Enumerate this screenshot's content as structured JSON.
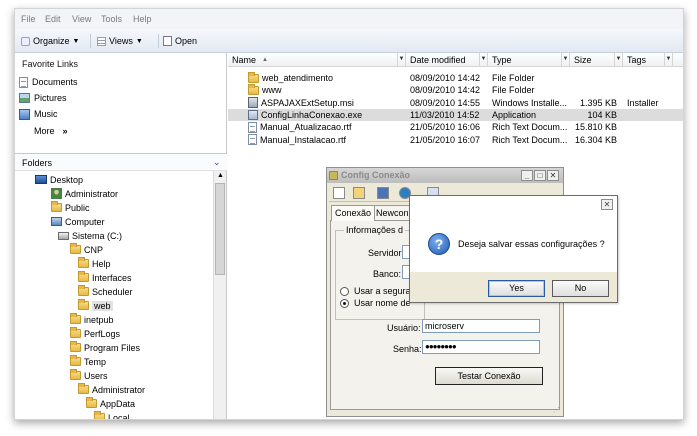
{
  "menu": [
    "File",
    "Edit",
    "View",
    "Tools",
    "Help"
  ],
  "toolbar": {
    "organize": "Organize",
    "views": "Views",
    "open": "Open"
  },
  "nav": {
    "favorites_title": "Favorite Links",
    "favorites": [
      {
        "label": "Documents",
        "icon": "documents-icon"
      },
      {
        "label": "Pictures",
        "icon": "pictures-icon"
      },
      {
        "label": "Music",
        "icon": "music-icon"
      }
    ],
    "more": "More",
    "more_chevron": "»",
    "folders_title": "Folders",
    "tree": [
      {
        "label": "Desktop",
        "icon": "desktop-icon",
        "level": 0
      },
      {
        "label": "Administrator",
        "icon": "user-icon",
        "level": 1
      },
      {
        "label": "Public",
        "icon": "folder-icon",
        "level": 1
      },
      {
        "label": "Computer",
        "icon": "computer-icon",
        "level": 1
      },
      {
        "label": "Sistema (C:)",
        "icon": "drive-icon",
        "level": 2
      },
      {
        "label": "CNP",
        "icon": "folder-icon",
        "level": 3
      },
      {
        "label": "Help",
        "icon": "folder-icon",
        "level": 4
      },
      {
        "label": "Interfaces",
        "icon": "folder-icon",
        "level": 4
      },
      {
        "label": "Scheduler",
        "icon": "folder-icon",
        "level": 4
      },
      {
        "label": "web",
        "icon": "folder-icon",
        "level": 4,
        "selected": true
      },
      {
        "label": "inetpub",
        "icon": "folder-icon",
        "level": 3
      },
      {
        "label": "PerfLogs",
        "icon": "folder-icon",
        "level": 3
      },
      {
        "label": "Program Files",
        "icon": "folder-icon",
        "level": 3
      },
      {
        "label": "Temp",
        "icon": "folder-icon",
        "level": 3
      },
      {
        "label": "Users",
        "icon": "folder-icon",
        "level": 3
      },
      {
        "label": "Administrator",
        "icon": "folder-icon",
        "level": 4
      },
      {
        "label": "AppData",
        "icon": "folder-icon",
        "level": 5
      },
      {
        "label": "Local",
        "icon": "folder-icon",
        "level": 6
      }
    ]
  },
  "columns": [
    "Name",
    "Date modified",
    "Type",
    "Size",
    "Tags"
  ],
  "files": [
    {
      "name": "web_atendimento",
      "date": "08/09/2010 14:42",
      "type": "File Folder",
      "size": "",
      "tags": "",
      "icon": "folder-icon"
    },
    {
      "name": "www",
      "date": "08/09/2010 14:42",
      "type": "File Folder",
      "size": "",
      "tags": "",
      "icon": "folder-icon"
    },
    {
      "name": "ASPAJAXExtSetup.msi",
      "date": "08/09/2010 14:55",
      "type": "Windows Installe...",
      "size": "1.395 KB",
      "tags": "Installer",
      "icon": "msi-icon"
    },
    {
      "name": "ConfigLinhaConexao.exe",
      "date": "11/03/2010 14:52",
      "type": "Application",
      "size": "104 KB",
      "tags": "",
      "icon": "exe-icon",
      "selected": true
    },
    {
      "name": "Manual_Atualizacao.rtf",
      "date": "21/05/2010 16:06",
      "type": "Rich Text Docum...",
      "size": "15.810 KB",
      "tags": "",
      "icon": "document-icon"
    },
    {
      "name": "Manual_Instalacao.rtf",
      "date": "21/05/2010 16:07",
      "type": "Rich Text Docum...",
      "size": "16.304 KB",
      "tags": "",
      "icon": "document-icon"
    }
  ],
  "config": {
    "title": "Config Conexão",
    "tabs": [
      "Conexão",
      "Newcon"
    ],
    "group_title": "Informações d",
    "servidor_label": "Servidor:",
    "servidor_value": "",
    "banco_label": "Banco:",
    "banco_value": "",
    "radio1": "Usar a segurar",
    "radio2": "Usar nome de",
    "usuario_label": "Usuário:",
    "usuario_value": "microserv",
    "senha_label": "Senha:",
    "senha_value": "●●●●●●●●",
    "test_button": "Testar Conexão"
  },
  "dialog": {
    "message": "Deseja salvar essas configurações ?",
    "yes": "Yes",
    "no": "No"
  }
}
